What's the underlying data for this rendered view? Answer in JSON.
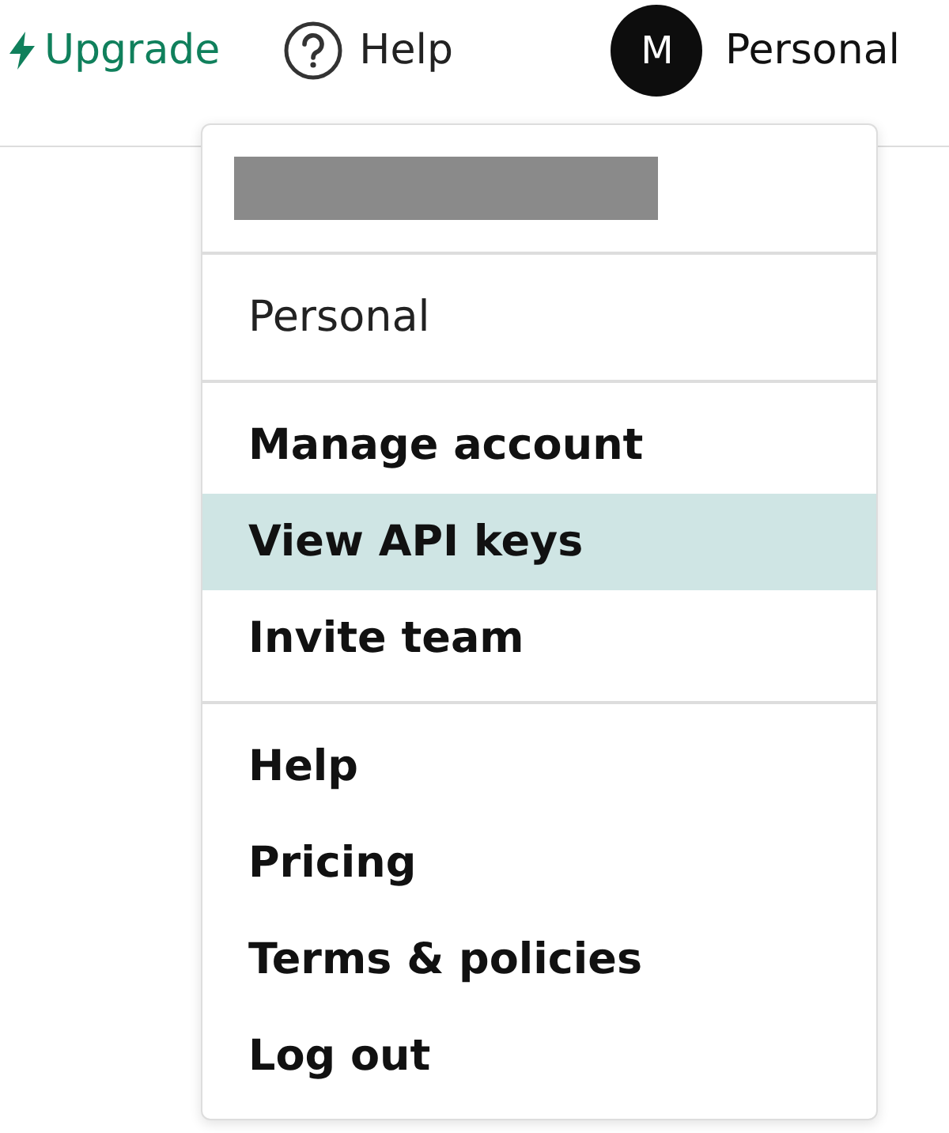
{
  "top_bar": {
    "upgrade": "Upgrade",
    "help": "Help",
    "avatar_initial": "M",
    "account": "Personal"
  },
  "menu": {
    "sections": [
      {
        "items": [
          {
            "label": "Personal",
            "kind": "label",
            "selected": false
          }
        ]
      },
      {
        "items": [
          {
            "label": "Manage account",
            "kind": "link",
            "selected": false
          },
          {
            "label": "View API keys",
            "kind": "link",
            "selected": true
          },
          {
            "label": "Invite team",
            "kind": "link",
            "selected": false
          }
        ]
      },
      {
        "items": [
          {
            "label": "Help",
            "kind": "link",
            "selected": false
          },
          {
            "label": "Pricing",
            "kind": "link",
            "selected": false
          },
          {
            "label": "Terms & policies",
            "kind": "link",
            "selected": false
          },
          {
            "label": "Log out",
            "kind": "link",
            "selected": false
          }
        ]
      }
    ]
  }
}
